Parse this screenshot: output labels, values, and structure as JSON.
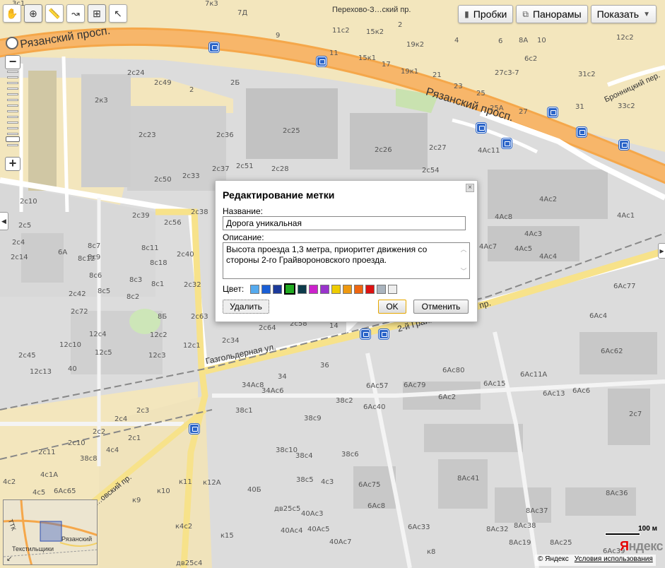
{
  "toolbar": {
    "tools": [
      {
        "name": "hand-tool",
        "glyph": "✋"
      },
      {
        "name": "zoom-tool",
        "glyph": "⊕"
      },
      {
        "name": "ruler-tool",
        "glyph": "📏"
      },
      {
        "name": "route-tool",
        "glyph": "↝"
      },
      {
        "name": "placemark-tool",
        "glyph": "⊞"
      },
      {
        "name": "select-tool",
        "glyph": "↖"
      }
    ],
    "traffic_label": "Пробки",
    "panoramas_label": "Панорамы",
    "show_label": "Показать"
  },
  "map": {
    "streets": {
      "ryazansky_1": "Рязанский просп.",
      "ryazansky_2": "Рязанский просп.",
      "gazgolder": "Газгольдерная ул.",
      "graivoron": "2-й Грайвороновский пр.",
      "bronnitsky": "Бронницкий пер.",
      "perovo": "Перехово-З…ский пр.",
      "graivoron_lower": "…овский пр."
    },
    "buildings": [
      "7к3",
      "3с1",
      "7Д",
      "9",
      "11с2",
      "15к2",
      "2",
      "19к2",
      "4",
      "6",
      "8А",
      "10",
      "12с2",
      "11",
      "15к1",
      "17",
      "19к1",
      "21",
      "6с2",
      "27с3-7",
      "31с2",
      "33с2",
      "2с24",
      "2с49",
      "2",
      "2Б",
      "2к3",
      "23",
      "25",
      "25А",
      "27",
      "31",
      "2с23",
      "2с36",
      "2с25",
      "2с26",
      "2с27",
      "4Ас11",
      "2с50",
      "2с33",
      "2с37",
      "2с51",
      "2с28",
      "2с54",
      "4Ас2",
      "2с10",
      "2с39",
      "2с38",
      "2с56",
      "4Ас8",
      "4Ас1",
      "2с5",
      "2с4",
      "6А",
      "8с7",
      "8с9",
      "8с11",
      "8с12",
      "8с18",
      "2с40",
      "4Ас3",
      "4Ас7",
      "4Ас5",
      "4Ас4",
      "2с14",
      "8с6",
      "8с3",
      "8с1",
      "2с42",
      "8с5",
      "8с2",
      "2с32",
      "2с72",
      "8Б",
      "2с63",
      "2с64",
      "2с58",
      "14",
      "12с4",
      "12с2",
      "12с10",
      "12с5",
      "12с3",
      "12с1",
      "2с34",
      "2с45",
      "12с13",
      "40",
      "36",
      "34",
      "34Ас8",
      "34Ас6",
      "38с1",
      "38с2",
      "6Ас40",
      "6Ас77",
      "6Ас4",
      "6Ас62",
      "6Ас80",
      "6Ас11А",
      "6Ас57",
      "6Ас79",
      "6Ас15",
      "6Ас13",
      "6Ас6",
      "6Ас2",
      "2с7",
      "2с4",
      "2с3",
      "2с2",
      "2с1",
      "4с4",
      "2с11",
      "2с10",
      "38с8",
      "38с9",
      "38с10",
      "38с4",
      "38с6",
      "38с5",
      "4с3",
      "4с1А",
      "4с2",
      "4с5",
      "6Ас65",
      "6Ас75",
      "6Ас8",
      "8Ас41",
      "8Ас36",
      "8Ас37",
      "8Ас38",
      "8Ас32",
      "8Ас25",
      "8Ас19",
      "6Ас39",
      "6Ас33",
      "к8",
      "к9",
      "к10",
      "к11",
      "к12А",
      "к15",
      "к4с2",
      "дв25с4",
      "40Б",
      "дв25с5",
      "40Ас4",
      "40Ас3",
      "40Ас5",
      "40Ас7"
    ]
  },
  "dialog": {
    "title": "Редактирование метки",
    "name_label": "Название:",
    "name_value": "Дорога уникальная",
    "description_label": "Описание:",
    "description_value": "Высота проезда 1,3 метра, приоритет движения со стороны 2-го Грайвороновского проезда.",
    "color_label": "Цвет:",
    "colors": [
      "#55aaee",
      "#1a5fd6",
      "#1c3a9a",
      "#22aa22",
      "#0c3a4a",
      "#cc22cc",
      "#9933cc",
      "#eecc00",
      "#ee9911",
      "#ee6611",
      "#dd1111",
      "#aab4be",
      "#eeeeee"
    ],
    "selected_color_index": 3,
    "delete_label": "Удалить",
    "ok_label": "OK",
    "cancel_label": "Отменить",
    "close_glyph": "×"
  },
  "minimap": {
    "label_ryazansky": "Рязанский",
    "label_textilshchiki": "Текстильщики",
    "label_ttk": "ТТК"
  },
  "scale": {
    "label": "100 м"
  },
  "logo": {
    "ya": "Я",
    "rest": "ндекс"
  },
  "footer": {
    "copyright": "© Яндекс",
    "terms": "Условия использования"
  }
}
